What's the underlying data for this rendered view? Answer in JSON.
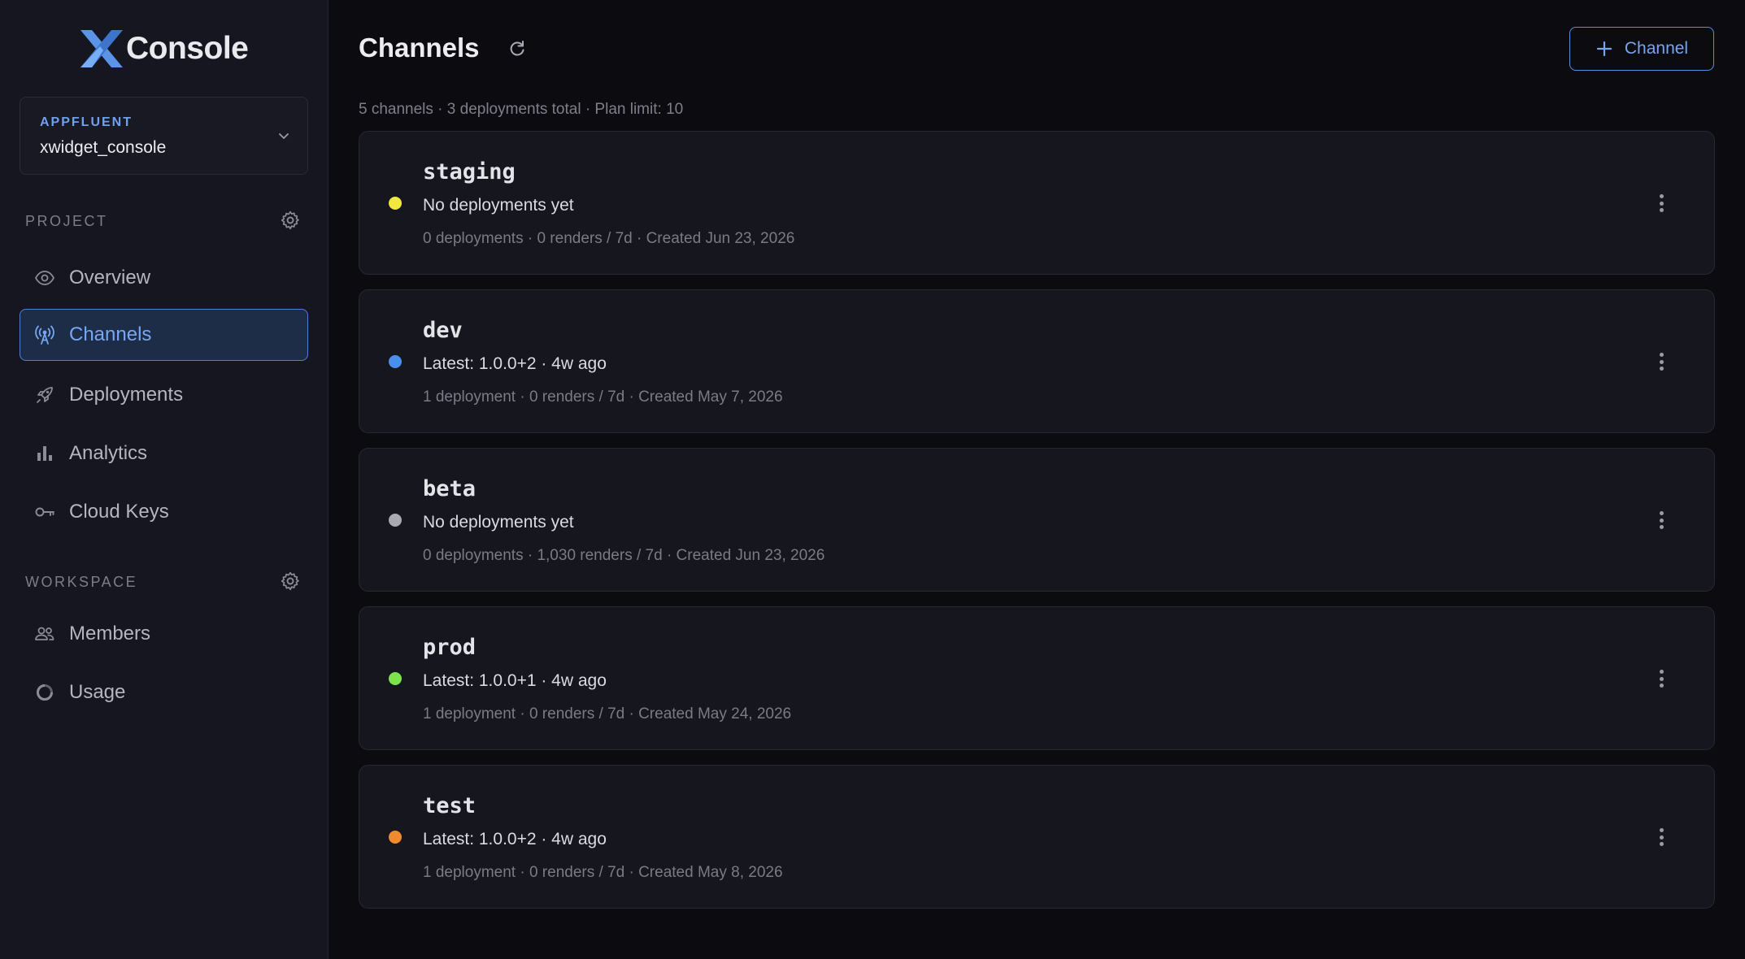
{
  "brand": {
    "logo_text": "Console"
  },
  "org_selector": {
    "org": "APPFLUENT",
    "project": "xwidget_console"
  },
  "sidebar": {
    "project_section": "PROJECT",
    "workspace_section": "WORKSPACE",
    "project_items": [
      {
        "label": "Overview",
        "icon": "eye-icon"
      },
      {
        "label": "Channels",
        "icon": "broadcast-icon",
        "active": true
      },
      {
        "label": "Deployments",
        "icon": "rocket-icon"
      },
      {
        "label": "Analytics",
        "icon": "bar-chart-icon"
      },
      {
        "label": "Cloud Keys",
        "icon": "key-icon"
      }
    ],
    "workspace_items": [
      {
        "label": "Members",
        "icon": "people-icon"
      },
      {
        "label": "Usage",
        "icon": "donut-icon"
      }
    ]
  },
  "main": {
    "title": "Channels",
    "add_button_label": "Channel",
    "summary": "5 channels · 3 deployments total · Plan limit: 10"
  },
  "channels": [
    {
      "name": "staging",
      "latest": "No deployments yet",
      "meta": "0 deployments · 0 renders / 7d · Created Jun 23, 2026",
      "color": "#f2e640"
    },
    {
      "name": "dev",
      "latest": "Latest: 1.0.0+2 · 4w ago",
      "meta": "1 deployment · 0 renders / 7d · Created May 7, 2026",
      "color": "#4a8ff0"
    },
    {
      "name": "beta",
      "latest": "No deployments yet",
      "meta": "0 deployments · 1,030 renders / 7d · Created Jun 23, 2026",
      "color": "#a9a9b0"
    },
    {
      "name": "prod",
      "latest": "Latest: 1.0.0+1 · 4w ago",
      "meta": "1 deployment · 0 renders / 7d · Created May 24, 2026",
      "color": "#7ee34a"
    },
    {
      "name": "test",
      "latest": "Latest: 1.0.0+2 · 4w ago",
      "meta": "1 deployment · 0 renders / 7d · Created May 8, 2026",
      "color": "#f08a2e"
    }
  ]
}
